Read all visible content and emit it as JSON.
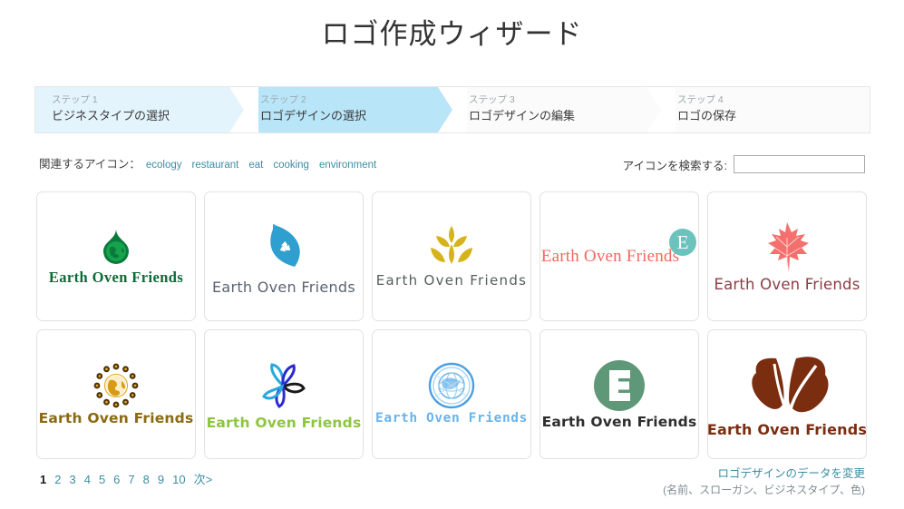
{
  "header": {
    "title": "ロゴ作成ウィザード"
  },
  "steps": [
    {
      "num": "ステップ 1",
      "label": "ビジネスタイプの選択",
      "state": "done"
    },
    {
      "num": "ステップ 2",
      "label": "ロゴデザインの選択",
      "state": "current"
    },
    {
      "num": "ステップ 3",
      "label": "ロゴデザインの編集",
      "state": "todo"
    },
    {
      "num": "ステップ 4",
      "label": "ロゴの保存",
      "state": "todo"
    }
  ],
  "tags": {
    "label": "関連するアイコン：",
    "items": [
      "ecology",
      "restaurant",
      "eat",
      "cooking",
      "environment"
    ]
  },
  "search": {
    "label": "アイコンを検索する:",
    "value": "",
    "placeholder": ""
  },
  "logos": [
    {
      "name": "Earth Oven Friends",
      "icon": "globe-droplet-icon",
      "color": "#0b6b35"
    },
    {
      "name": "Earth Oven Friends",
      "icon": "recycle-leaf-icon",
      "color": "#2f9fd0"
    },
    {
      "name": "Earth Oven Friends",
      "icon": "wheat-sprout-icon",
      "color": "#d6b31b"
    },
    {
      "name": "Earth Oven Friends",
      "icon": "letter-e-circle-icon",
      "color": "#6cc3bd"
    },
    {
      "name": "Earth Oven Friends",
      "icon": "maple-leaf-icon",
      "color": "#f4706e"
    },
    {
      "name": "Earth Oven Friends",
      "icon": "globe-gear-ring-icon",
      "color": "#8a6a12"
    },
    {
      "name": "Earth Oven Friends",
      "icon": "pinwheel-leaves-icon",
      "color": "#2a2ad0"
    },
    {
      "name": "Earth Oven Friends",
      "icon": "globe-orbit-icon",
      "color": "#6ab4ea"
    },
    {
      "name": "Earth Oven Friends",
      "icon": "letter-e-circle-bold-icon",
      "color": "#5f9878"
    },
    {
      "name": "Earth Oven Friends",
      "icon": "two-leaves-icon",
      "color": "#7b2d10"
    }
  ],
  "pagination": {
    "pages": [
      "1",
      "2",
      "3",
      "4",
      "5",
      "6",
      "7",
      "8",
      "9",
      "10"
    ],
    "current": "1",
    "next_label": "次>"
  },
  "edit_link": {
    "line1": "ロゴデザインのデータを変更",
    "line2": "(名前、スローガン、ビジネスタイプ、色)"
  },
  "colors": {
    "step_done": "#e4f4fc",
    "step_current": "#b9e5f8",
    "step_todo": "#fbfbfb",
    "link": "#3c8ea3"
  }
}
